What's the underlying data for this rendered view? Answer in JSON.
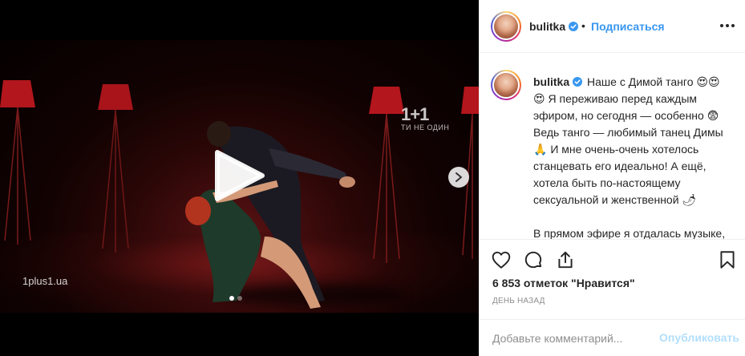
{
  "post": {
    "username": "bulitka",
    "follow_label": "Подписаться",
    "separator": "•",
    "caption": "Наше с Димой танго 😍😍\n😍 Я переживаю перед каждым эфиром, но сегодня — особенно 😨\nВедь танго — любимый танец Димы 🙏 И мне очень-очень хотелось станцевать его идеально! А ещё, хотела быть по-настоящему сексуальной и женственной 🌶\n\nВ прямом эфире я отдалась музыке, страсти и... вот, что получилось 🤍",
    "likes": "6 853 отметок \"Нравится\"",
    "date": "ДЕНЬ НАЗАД",
    "comment_placeholder": "Добавьте комментарий...",
    "publish_label": "Опубликовать"
  },
  "media": {
    "channel_logo": "1+1",
    "channel_tagline": "ТИ НЕ ОДИН",
    "watermark": "1plus1.ua",
    "carousel_total": 2,
    "carousel_active": 1
  },
  "colors": {
    "link_blue": "#3897f0",
    "publish_disabled": "#b2dffc",
    "verified_blue": "#3897f0",
    "stage_red": "#5a1214"
  },
  "icons": [
    "play-icon",
    "chevron-right-icon",
    "heart-icon",
    "comment-icon",
    "share-icon",
    "bookmark-icon",
    "verified-icon",
    "more-icon"
  ]
}
